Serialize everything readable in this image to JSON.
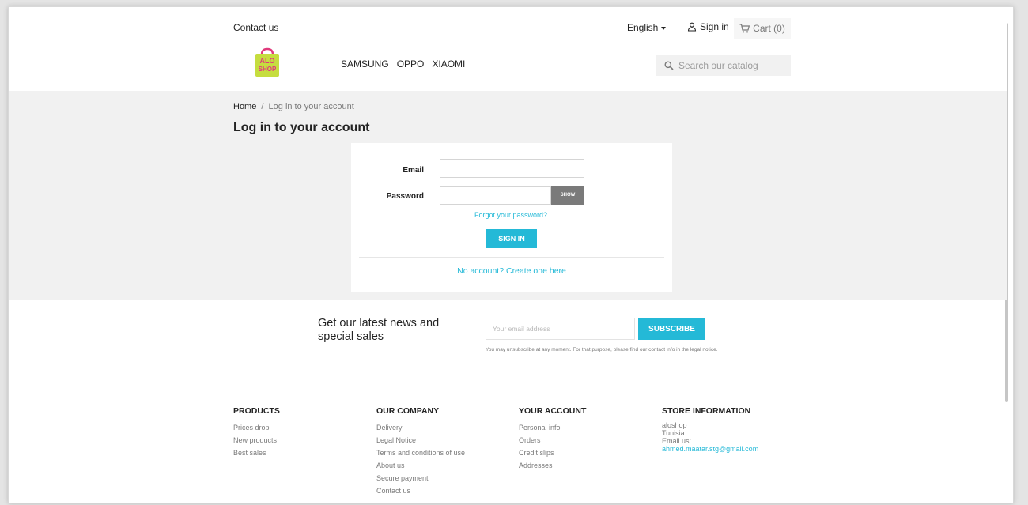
{
  "header": {
    "contact": "Contact us",
    "language": "English",
    "signin": "Sign in",
    "cart": "Cart (0)",
    "logo_text": [
      "ALO",
      "SHOP"
    ],
    "nav": [
      "SAMSUNG",
      "OPPO",
      "XIAOMI"
    ],
    "search_placeholder": "Search our catalog"
  },
  "breadcrumb": {
    "home": "Home",
    "separator": "/",
    "current": "Log in to your account"
  },
  "page_title": "Log in to your account",
  "login": {
    "email_label": "Email",
    "email_value": "",
    "password_label": "Password",
    "password_value": "",
    "show_label": "SHOW",
    "forgot": "Forgot your password?",
    "signin_btn": "SIGN IN",
    "create": "No account? Create one here"
  },
  "newsletter": {
    "title": "Get our latest news and special sales",
    "placeholder": "Your email address",
    "subscribe": "SUBSCRIBE",
    "note": "You may unsubscribe at any moment. For that purpose, please find our contact info in the legal notice."
  },
  "footer": {
    "products": {
      "title": "PRODUCTS",
      "items": [
        "Prices drop",
        "New products",
        "Best sales"
      ]
    },
    "company": {
      "title": "OUR COMPANY",
      "items": [
        "Delivery",
        "Legal Notice",
        "Terms and conditions of use",
        "About us",
        "Secure payment",
        "Contact us"
      ]
    },
    "account": {
      "title": "YOUR ACCOUNT",
      "items": [
        "Personal info",
        "Orders",
        "Credit slips",
        "Addresses"
      ]
    },
    "store": {
      "title": "STORE INFORMATION",
      "lines": [
        "aloshop",
        "Tunisia",
        "Email us:"
      ],
      "email": "ahmed.maatar.stg@gmail.com"
    }
  },
  "colors": {
    "accent": "#24b9d7",
    "text": "#232323",
    "muted": "#7a7a7a",
    "logo_green": "#c6dd3f",
    "logo_pink": "#e0397c"
  }
}
